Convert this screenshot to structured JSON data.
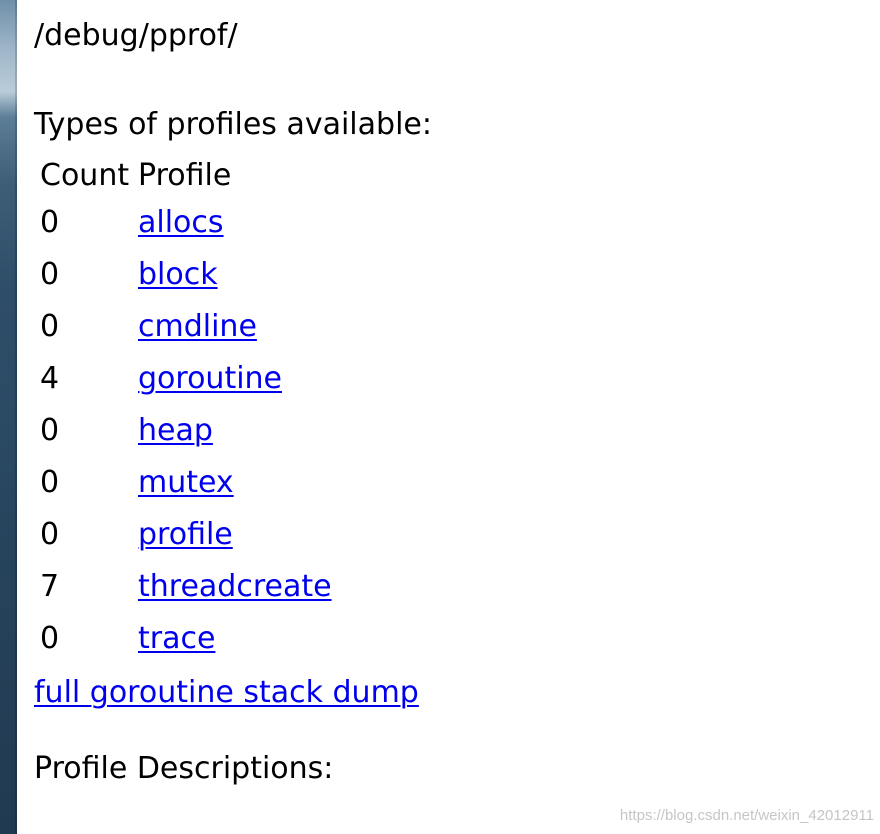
{
  "page": {
    "path_heading": "/debug/pprof/",
    "types_heading": "Types of profiles available:",
    "table_headers": {
      "count": "Count",
      "profile": "Profile"
    },
    "profiles": [
      {
        "count": "0",
        "name": "allocs"
      },
      {
        "count": "0",
        "name": "block"
      },
      {
        "count": "0",
        "name": "cmdline"
      },
      {
        "count": "4",
        "name": "goroutine"
      },
      {
        "count": "0",
        "name": "heap"
      },
      {
        "count": "0",
        "name": "mutex"
      },
      {
        "count": "0",
        "name": "profile"
      },
      {
        "count": "7",
        "name": "threadcreate"
      },
      {
        "count": "0",
        "name": "trace"
      }
    ],
    "full_dump_link": "full goroutine stack dump",
    "descriptions_heading": "Profile Descriptions:"
  },
  "watermark": "https://blog.csdn.net/weixin_42012911",
  "colors": {
    "link": "#0000ee",
    "text": "#000000",
    "background": "#ffffff"
  }
}
